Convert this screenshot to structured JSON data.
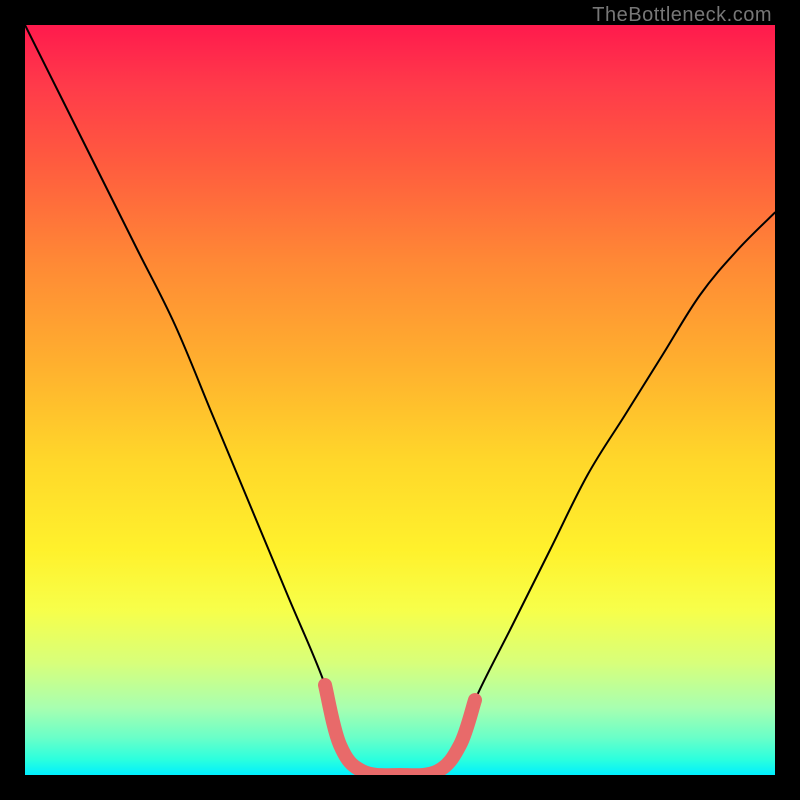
{
  "watermark": "TheBottleneck.com",
  "chart_data": {
    "type": "line",
    "title": "",
    "xlabel": "",
    "ylabel": "",
    "xlim": [
      0,
      100
    ],
    "ylim": [
      0,
      100
    ],
    "background": "rainbow-vertical-gradient",
    "series": [
      {
        "name": "bottleneck-curve",
        "color": "#000000",
        "x": [
          0,
          5,
          10,
          15,
          20,
          25,
          30,
          35,
          40,
          42,
          45,
          50,
          55,
          58,
          60,
          65,
          70,
          75,
          80,
          85,
          90,
          95,
          100
        ],
        "values": [
          100,
          90,
          80,
          70,
          60,
          48,
          36,
          24,
          12,
          4,
          0.5,
          0,
          0.5,
          4,
          10,
          20,
          30,
          40,
          48,
          56,
          64,
          70,
          75
        ]
      },
      {
        "name": "optimal-zone-highlight",
        "color": "#e86a6a",
        "x": [
          40,
          42,
          45,
          50,
          55,
          58,
          60
        ],
        "values": [
          12,
          4,
          0.5,
          0,
          0.5,
          4,
          10
        ]
      }
    ]
  }
}
